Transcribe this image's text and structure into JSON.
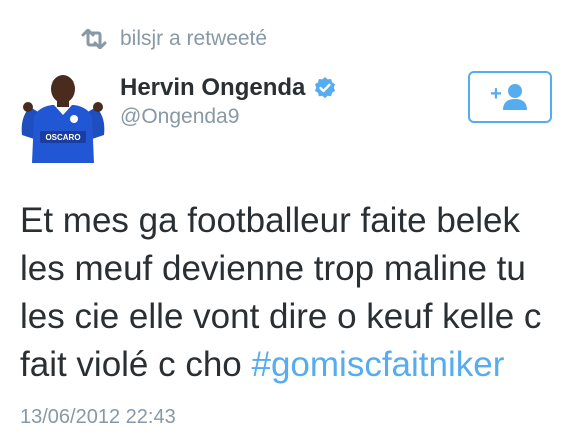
{
  "retweet": {
    "icon": "retweet-icon",
    "text": "bilsjr a retweeté"
  },
  "author": {
    "avatar_icon": "avatar",
    "name": "Hervin Ongenda",
    "verified_icon": "verified-badge-icon",
    "handle": "@Ongenda9",
    "jersey_text": "OSCARO"
  },
  "follow_button": {
    "icon": "add-user-icon",
    "label": "+"
  },
  "tweet": {
    "text": "Et mes ga footballeur faite belek les meuf devienne trop maline tu les cie elle vont dire o keuf kelle c fait violé c cho ",
    "hashtag": "#gomiscfaitniker"
  },
  "timestamp": "13/06/2012 22:43",
  "colors": {
    "accent": "#55acee",
    "secondary_text": "#8899a6",
    "primary_text": "#292f33"
  }
}
